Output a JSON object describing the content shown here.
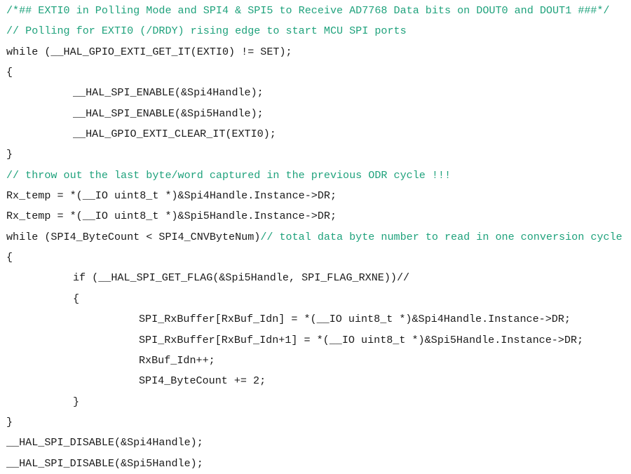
{
  "code": {
    "comment_color": "#1fa27c",
    "lines": [
      {
        "indent": 0,
        "code": "",
        "comment": "/*## EXTI0 in Polling Mode and SPI4 & SPI5 to Receive AD7768 Data bits on DOUT0 and DOUT1 ###*/"
      },
      {
        "indent": 0,
        "code": "",
        "comment": "// Polling for EXTI0 (/DRDY) rising edge to start MCU SPI ports"
      },
      {
        "indent": 0,
        "code": "while (__HAL_GPIO_EXTI_GET_IT(EXTI0) != SET);",
        "comment": ""
      },
      {
        "indent": 0,
        "code": "{",
        "comment": ""
      },
      {
        "indent": 1,
        "code": "__HAL_SPI_ENABLE(&Spi4Handle);",
        "comment": ""
      },
      {
        "indent": 1,
        "code": "__HAL_SPI_ENABLE(&Spi5Handle);",
        "comment": ""
      },
      {
        "indent": 1,
        "code": "__HAL_GPIO_EXTI_CLEAR_IT(EXTI0);",
        "comment": ""
      },
      {
        "indent": 0,
        "code": "}",
        "comment": ""
      },
      {
        "indent": 0,
        "code": "",
        "comment": "// throw out the last byte/word captured in the previous ODR cycle !!!"
      },
      {
        "indent": 0,
        "code": "Rx_temp = *(__IO uint8_t *)&Spi4Handle.Instance->DR;",
        "comment": ""
      },
      {
        "indent": 0,
        "code": "Rx_temp = *(__IO uint8_t *)&Spi5Handle.Instance->DR;",
        "comment": ""
      },
      {
        "indent": 0,
        "code": "while (SPI4_ByteCount < SPI4_CNVByteNum)",
        "comment": "// total data byte number to read in one conversion cycle"
      },
      {
        "indent": 0,
        "code": "{",
        "comment": ""
      },
      {
        "indent": 1,
        "code": "if (__HAL_SPI_GET_FLAG(&Spi5Handle, SPI_FLAG_RXNE))//",
        "comment": ""
      },
      {
        "indent": 1,
        "code": "{",
        "comment": ""
      },
      {
        "indent": 2,
        "code": "SPI_RxBuffer[RxBuf_Idn] = *(__IO uint8_t *)&Spi4Handle.Instance->DR;",
        "comment": ""
      },
      {
        "indent": 2,
        "code": "SPI_RxBuffer[RxBuf_Idn+1] = *(__IO uint8_t *)&Spi5Handle.Instance->DR;",
        "comment": ""
      },
      {
        "indent": 2,
        "code": "RxBuf_Idn++;",
        "comment": ""
      },
      {
        "indent": 2,
        "code": "SPI4_ByteCount += 2;",
        "comment": ""
      },
      {
        "indent": 1,
        "code": "}",
        "comment": ""
      },
      {
        "indent": 0,
        "code": "}",
        "comment": ""
      },
      {
        "indent": 0,
        "code": "__HAL_SPI_DISABLE(&Spi4Handle);",
        "comment": ""
      },
      {
        "indent": 0,
        "code": "__HAL_SPI_DISABLE(&Spi5Handle);",
        "comment": ""
      }
    ]
  }
}
